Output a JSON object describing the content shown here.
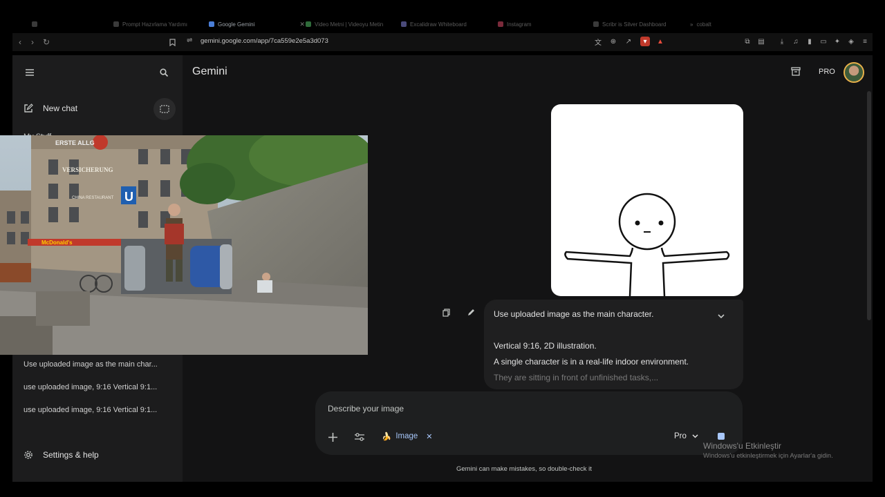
{
  "browser": {
    "tabs": [
      {
        "label": "",
        "active": false
      },
      {
        "label": "Prompt Hazırlama Yardımı",
        "active": false
      },
      {
        "label": "Google Gemini",
        "active": true
      },
      {
        "label": "Video Metni | Videoyu Metin",
        "active": false
      },
      {
        "label": "Excalidraw Whiteboard",
        "active": false
      },
      {
        "label": "Instagram",
        "active": false
      },
      {
        "label": "Scribr is Silver Dashboard",
        "active": false
      },
      {
        "label": "cobalt",
        "active": false
      }
    ],
    "url": "gemini.google.com/app/7ca559e2e5a3d073"
  },
  "sidebar": {
    "new_chat": "New chat",
    "my_stuff": "My Stuff",
    "recent": [
      "Use uploaded image as the main char...",
      "use uploaded image, 9:16 Vertical 9:1...",
      "use uploaded image, 9:16 Vertical 9:1..."
    ],
    "settings": "Settings & help"
  },
  "header": {
    "brand": "Gemini",
    "pro": "PRO"
  },
  "message": {
    "line1": "Use uploaded image as the main character.",
    "line2": "Vertical 9:16, 2D illustration.",
    "line3": "A single character is in a real-life indoor environment.",
    "line4": "They are sitting in front of unfinished tasks,..."
  },
  "composer": {
    "placeholder": "Describe your image",
    "chip_label": "Image",
    "chip_emoji": "🍌",
    "model": "Pro"
  },
  "disclaimer": "Gemini can make mistakes, so double-check it",
  "windows": {
    "title": "Windows'u Etkinleştir",
    "subtitle": "Windows'u etkinleştirmek için Ayarlar'a gidin."
  },
  "overlay_signs": {
    "top": "ERSTE ALLG",
    "insurance": "VERSICHERUNG",
    "ubahn": "U",
    "restaurant": "CHINA RESTAURANT",
    "mcd": "McDonald's"
  }
}
